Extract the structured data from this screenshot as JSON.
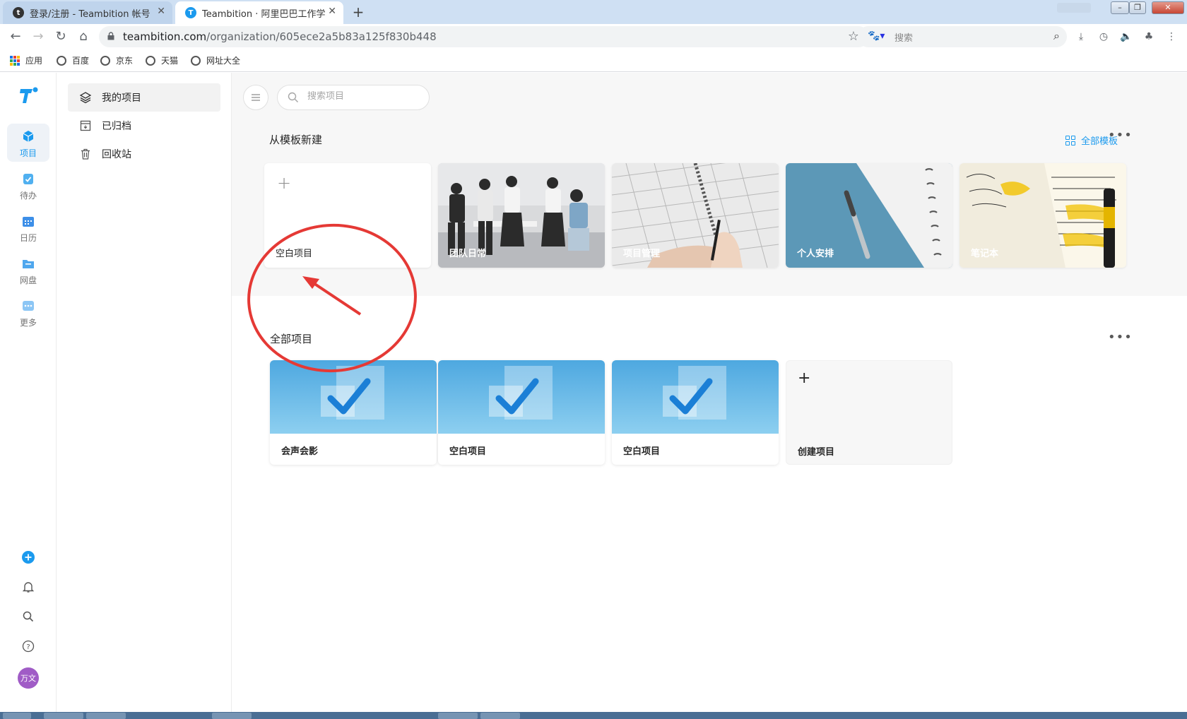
{
  "browser": {
    "tabs": [
      {
        "title": "登录/注册 - Teambition 帐号",
        "active": false,
        "favicon": "t"
      },
      {
        "title": "Teambition · 阿里巴巴工作学习",
        "active": true,
        "favicon": "teambition-icon"
      }
    ],
    "url_host": "teambition.com",
    "url_path": "/organization/605ece2a5b83a125f830b448",
    "search_placeholder": "搜索",
    "bookmarks": [
      "应用",
      "百度",
      "京东",
      "天猫",
      "网址大全"
    ]
  },
  "rail": {
    "items": [
      {
        "label": "项目",
        "icon": "cube-icon",
        "color": "#1b9aee"
      },
      {
        "label": "待办",
        "icon": "clipboard-check-icon",
        "color": "#50b0f0"
      },
      {
        "label": "日历",
        "icon": "calendar-icon",
        "color": "#3d8fe8"
      },
      {
        "label": "网盘",
        "icon": "folder-icon",
        "color": "#4fa7ee"
      },
      {
        "label": "更多",
        "icon": "more-icon",
        "color": "#8cc6f5"
      }
    ],
    "avatar_text": "万文",
    "avatar_color": "#a05cc6"
  },
  "sidebar": {
    "items": [
      {
        "label": "我的项目",
        "icon": "layers-icon",
        "active": true
      },
      {
        "label": "已归档",
        "icon": "archive-icon",
        "active": false
      },
      {
        "label": "回收站",
        "icon": "trash-icon",
        "active": false
      }
    ]
  },
  "main": {
    "search_placeholder": "搜索项目",
    "templates_title": "从模板新建",
    "all_templates_label": "全部模板",
    "templates": [
      {
        "label": "空白项目",
        "kind": "blank"
      },
      {
        "label": "团队日常",
        "kind": "photo-team"
      },
      {
        "label": "项目管理",
        "kind": "photo-planning"
      },
      {
        "label": "个人安排",
        "kind": "photo-notebook-blue"
      },
      {
        "label": "笔记本",
        "kind": "photo-notes-yellow"
      }
    ],
    "projects_title": "全部项目",
    "projects": [
      {
        "label": "会声会影"
      },
      {
        "label": "空白项目"
      },
      {
        "label": "空白项目"
      }
    ],
    "create_label": "创建项目"
  },
  "colors": {
    "accent": "#1b9aee",
    "annotation": "#e53935"
  }
}
